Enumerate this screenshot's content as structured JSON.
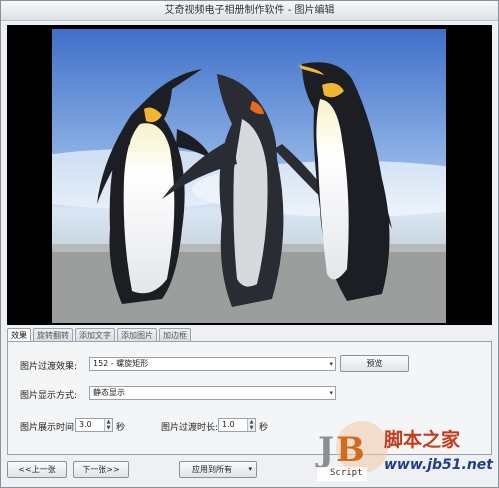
{
  "window": {
    "title": "艾奇视频电子相册制作软件 - 图片编辑"
  },
  "tabs": [
    "效果",
    "旋转翻转",
    "添加文字",
    "添加图片",
    "加边框"
  ],
  "effects": {
    "transition_label": "图片过渡效果:",
    "transition_value": "152 - 螺旋矩形",
    "preview_label": "预览",
    "display_label": "图片显示方式:",
    "display_value": "静态显示",
    "show_time_label": "图片展示时间:",
    "show_time_value": "3.0",
    "show_time_unit": "秒",
    "transition_time_label": "图片过渡时长:",
    "transition_time_value": "1.0",
    "transition_time_unit": "秒"
  },
  "footer": {
    "prev_label": "<<上一张",
    "next_label": "下一张>>",
    "apply_all_label": "应用到所有"
  },
  "watermark": {
    "brand_cn": "脚本之家",
    "script_label": "Script",
    "url": "www.jb51.net"
  }
}
